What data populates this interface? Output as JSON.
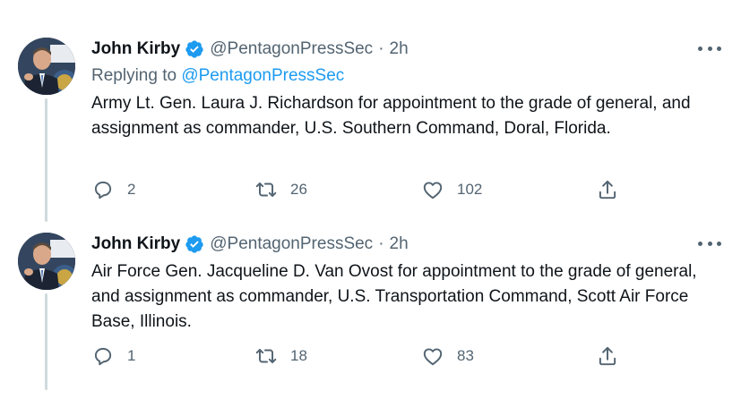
{
  "tweets": [
    {
      "author_name": "John Kirby",
      "author_handle": "@PentagonPressSec",
      "separator": "·",
      "time": "2h",
      "replying_prefix": "Replying to",
      "replying_handle": "@PentagonPressSec",
      "text": "Army Lt. Gen. Laura J. Richardson for appointment to the grade of general, and assignment as commander, U.S. Southern Command, Doral, Florida.",
      "replies": "2",
      "retweets": "26",
      "likes": "102"
    },
    {
      "author_name": "John Kirby",
      "author_handle": "@PentagonPressSec",
      "separator": "·",
      "time": "2h",
      "text": "Air Force Gen. Jacqueline D. Van Ovost for appointment to the grade of general, and assignment as commander, U.S. Transportation Command, Scott Air Force Base, Illinois.",
      "replies": "1",
      "retweets": "18",
      "likes": "83"
    }
  ],
  "icons": {
    "verified": "verified-badge-icon",
    "more": "more-dots-icon",
    "reply": "reply-bubble-icon",
    "retweet": "retweet-arrows-icon",
    "like": "heart-icon",
    "share": "share-upload-icon"
  },
  "colors": {
    "text": "#0f1419",
    "secondary": "#536471",
    "accent": "#1d9bf0",
    "thread_line": "#cfd9de"
  }
}
